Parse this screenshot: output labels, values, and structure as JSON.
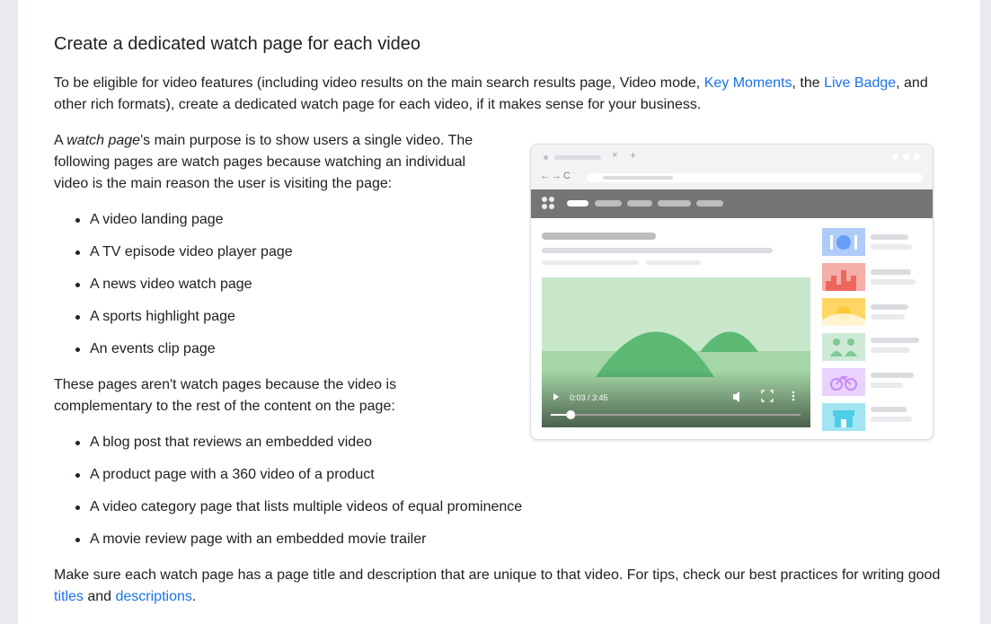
{
  "heading": "Create a dedicated watch page for each video",
  "intro": {
    "before": "To be eligible for video features (including video results on the main search results page, Video mode, ",
    "link1": "Key Moments",
    "mid": ", the ",
    "link2": "Live Badge",
    "after": ", and other rich formats), create a dedicated watch page for each video, if it makes sense for your business."
  },
  "watch_page_para": {
    "prefix": "A ",
    "em": "watch page",
    "rest": "'s main purpose is to show users a single video. The following pages are watch pages because watching an individual video is the main reason the user is visiting the page:"
  },
  "watch_pages": [
    "A video landing page",
    "A TV episode video player page",
    "A news video watch page",
    "A sports highlight page",
    "An events clip page"
  ],
  "not_watch_para": "These pages aren't watch pages because the video is complementary to the rest of the content on the page:",
  "not_watch_pages": [
    "A blog post that reviews an embedded video",
    "A product page with a 360 video of a product",
    "A video category page that lists multiple videos of equal prominence",
    "A movie review page with an embedded movie trailer"
  ],
  "final": {
    "before": "Make sure each watch page has a page title and description that are unique to that video. For tips, check our best practices for writing good ",
    "link1": "titles",
    "mid": " and ",
    "link2": "descriptions",
    "after": "."
  },
  "illustration": {
    "time": "0:03 / 3:45",
    "progress": 0.08,
    "colors": {
      "video_bg": "#c8e6c9",
      "mountain": "#5bb974",
      "appbar": "#757575",
      "thumb_food": "#aecbfa",
      "thumb_city": "#f6aea9",
      "thumb_landscape": "#fdd663",
      "thumb_people": "#ceead6",
      "thumb_bike": "#e9d2fd",
      "thumb_store": "#a1e4f2"
    },
    "icons": [
      "food-icon",
      "city-icon",
      "landscape-icon",
      "people-icon",
      "bike-icon",
      "store-icon"
    ]
  }
}
